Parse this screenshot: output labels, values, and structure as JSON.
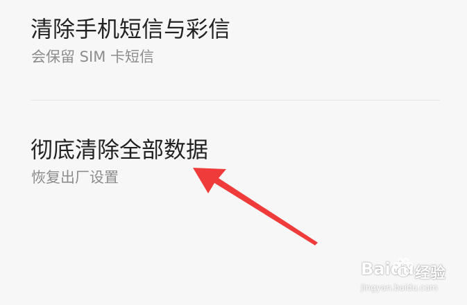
{
  "settings": {
    "items": [
      {
        "title": "清除手机短信与彩信",
        "subtitle": "会保留 SIM 卡短信"
      },
      {
        "title": "彻底清除全部数据",
        "subtitle": "恢复出厂设置"
      }
    ]
  },
  "watermark": {
    "logo_text": "Baidu",
    "product_text": "经验",
    "url": "jingyan.baidu.com"
  },
  "colors": {
    "background": "#f7f7f7",
    "title_text": "#222222",
    "subtitle_text": "#8c8c8c",
    "divider": "#e6e6e6",
    "annotation_arrow": "#f03b3b"
  },
  "icons": {
    "annotation": "red-arrow-icon",
    "watermark_logo": "baidu-paw-icon"
  }
}
